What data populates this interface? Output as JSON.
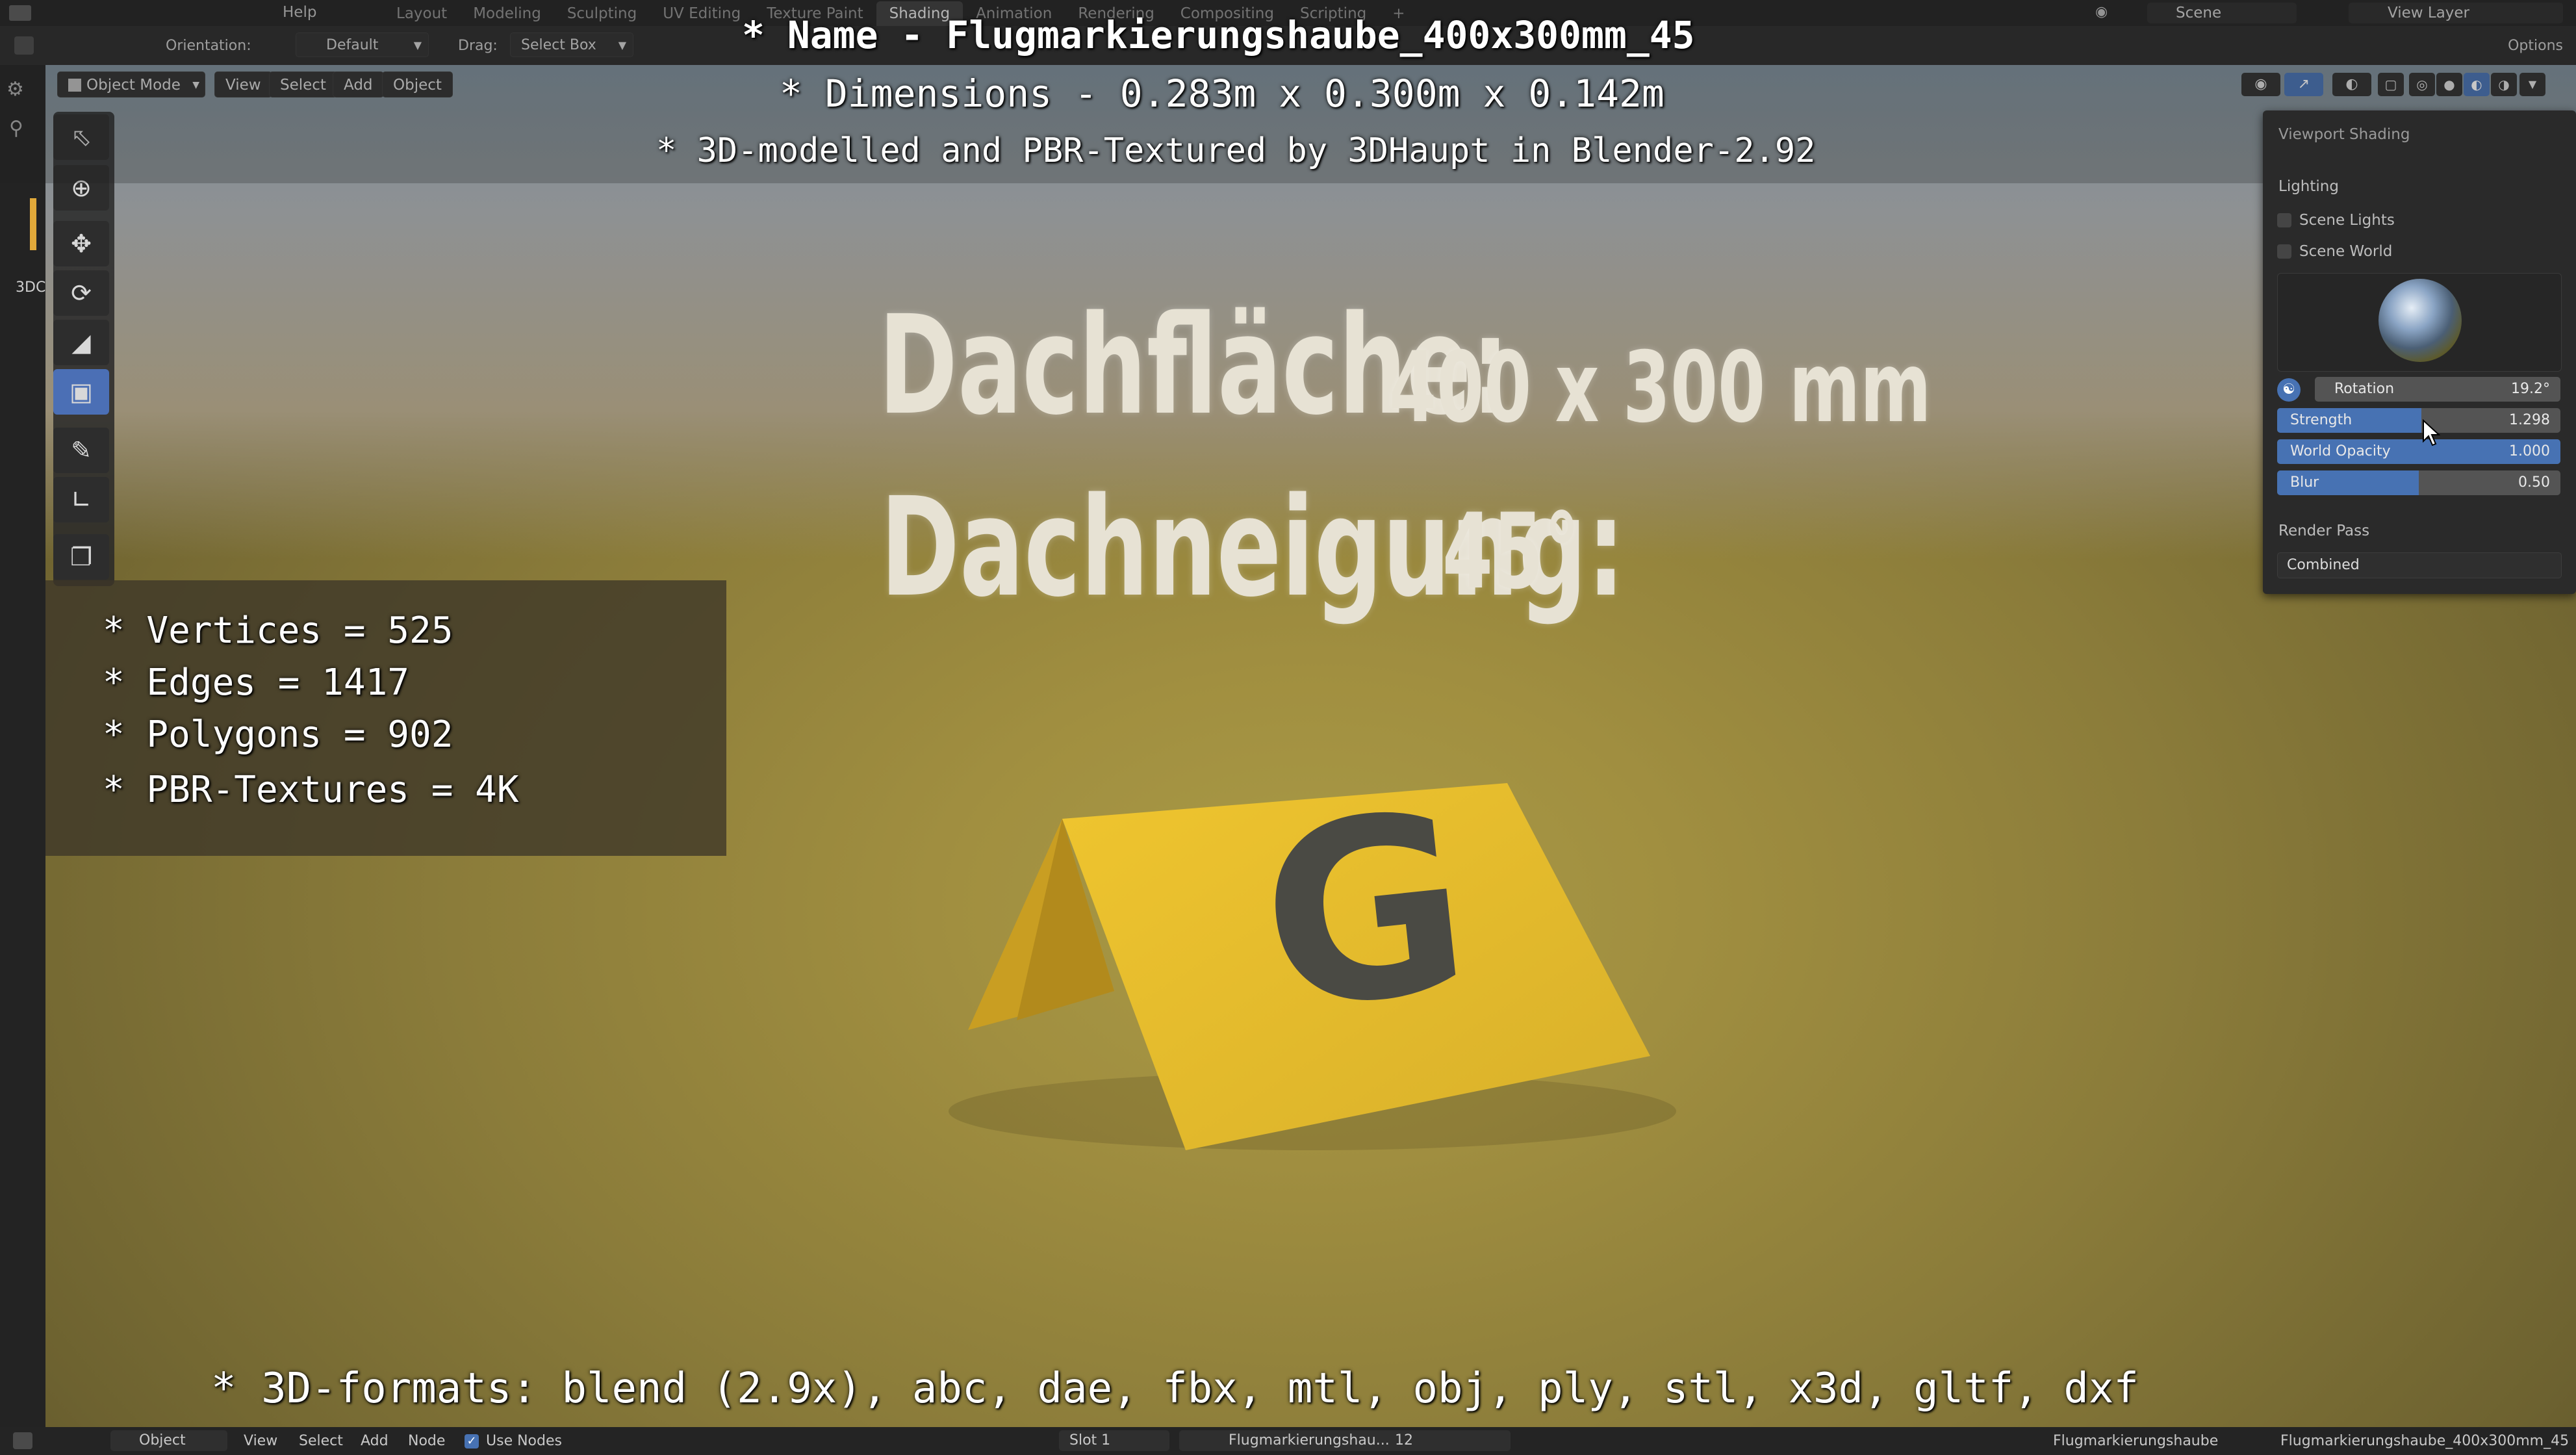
{
  "topbar": {
    "menu": [
      "Help"
    ],
    "workspaces": [
      "Layout",
      "Modeling",
      "Sculpting",
      "UV Editing",
      "Texture Paint",
      "Shading",
      "Animation",
      "Rendering",
      "Compositing",
      "Scripting"
    ],
    "active_workspace": "Shading",
    "add_tab": "+",
    "scene": "Scene",
    "view_layer": "View Layer",
    "options": "Options"
  },
  "header2": {
    "orientation_label": "Orientation:",
    "orientation_value": "Default",
    "drag_label": "Drag:",
    "drag_value": "Select Box"
  },
  "viewport_header": {
    "mode": "Object Mode",
    "view": "View",
    "select": "Select",
    "add": "Add",
    "object": "Object"
  },
  "side_label": "3DC",
  "overlay": {
    "title_line1": "* Name - Flugmarkierungshaube_400x300mm_45",
    "title_line2": "* Dimensions -  0.283m x 0.300m x 0.142m",
    "title_line3": "* 3D-modelled and PBR-Textured by 3DHaupt in Blender-2.92",
    "stats": [
      "* Vertices = 525",
      "* Edges = 1417",
      "* Polygons = 902",
      "* PBR-Textures = 4K"
    ],
    "formats": "* 3D-formats: blend (2.9x), abc, dae, fbx, mtl, obj, ply, stl, x3d, gltf, dxf"
  },
  "backdrop": {
    "line1_label": "Dachfläche:",
    "line1_value": "400 x 300 mm",
    "line2_label": "Dachneigung:",
    "line2_value": "45°"
  },
  "sign": {
    "letter": "G",
    "color": "#e2bd2c"
  },
  "viewport_shading": {
    "title": "Viewport Shading",
    "lighting_label": "Lighting",
    "scene_lights": "Scene Lights",
    "scene_world": "Scene World",
    "rotation_label": "Rotation",
    "rotation_value": "19.2°",
    "sliders": [
      {
        "name": "Strength",
        "value": "1.298",
        "fill": 0.51
      },
      {
        "name": "World Opacity",
        "value": "1.000",
        "fill": 1.0
      },
      {
        "name": "Blur",
        "value": "0.50",
        "fill": 0.5
      }
    ],
    "render_pass_label": "Render Pass",
    "render_pass_value": "Combined"
  },
  "bottombar": {
    "object": "Object",
    "view": "View",
    "select": "Select",
    "add": "Add",
    "node": "Node",
    "use_nodes": "Use Nodes",
    "slot": "Slot 1",
    "material": "Flugmarkierungshau...",
    "users": "12",
    "object_name": "Flugmarkierungshaube",
    "mesh_name": "Flugmarkierungshaube_400x300mm_45"
  },
  "colors": {
    "accent": "#4772b3",
    "slider_bg": "#545454",
    "panel_bg": "#2a2a2a"
  }
}
